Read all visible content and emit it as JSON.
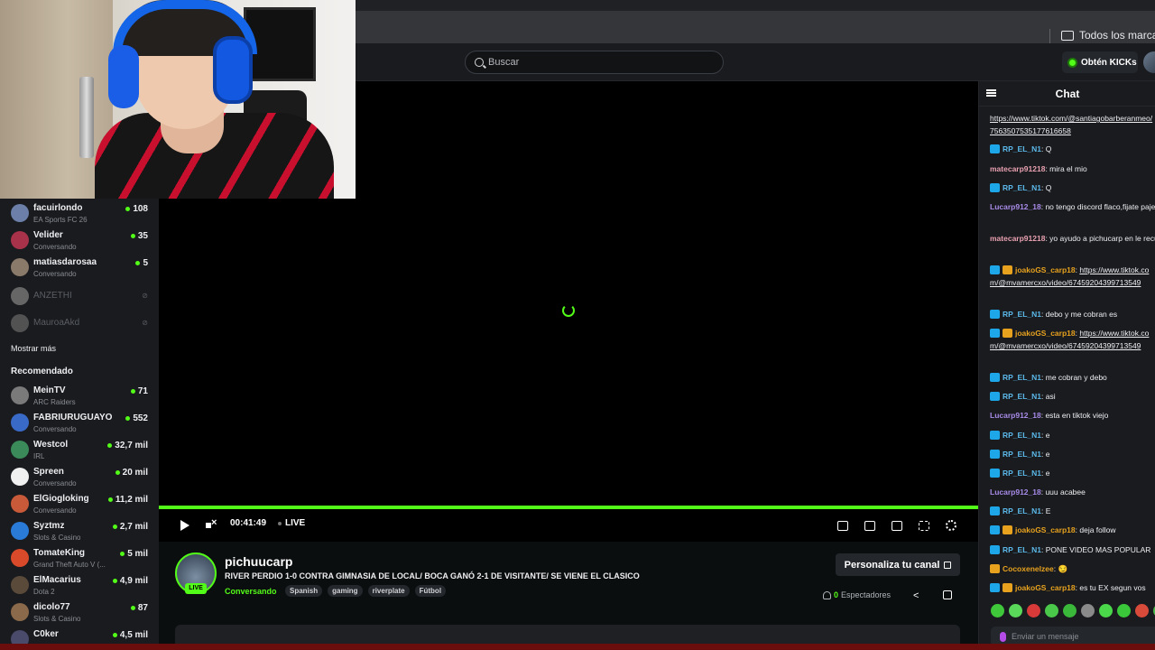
{
  "bookmarks": {
    "folder_label": "Todos los marcad"
  },
  "topnav": {
    "search_placeholder": "Buscar",
    "kicks_label": "Obtén KICKs"
  },
  "sidebar": {
    "following": [
      {
        "name": "facuirlondo",
        "sub": "EA Sports FC 26",
        "count": "108",
        "avatar": "#6b7fa8"
      },
      {
        "name": "Velider",
        "sub": "Conversando",
        "count": "35",
        "avatar": "#a8324a"
      },
      {
        "name": "matiasdarosaa",
        "sub": "Conversando",
        "count": "5",
        "avatar": "#8a7a6a"
      }
    ],
    "offline": [
      {
        "name": "ANZETHI",
        "avatar": "#aaaaaa"
      },
      {
        "name": "MauroaAkd",
        "avatar": "#888888"
      }
    ],
    "show_more": "Mostrar más",
    "recommended_heading": "Recomendado",
    "recommended": [
      {
        "name": "MeinTV",
        "sub": "ARC Raiders",
        "count": "71",
        "avatar": "#7a7a7a"
      },
      {
        "name": "FABRIURUGUAYO",
        "sub": "Conversando",
        "count": "552",
        "avatar": "#3a6ac8"
      },
      {
        "name": "Westcol",
        "sub": "IRL",
        "count": "32,7 mil",
        "avatar": "#3a8a5a"
      },
      {
        "name": "Spreen",
        "sub": "Conversando",
        "count": "20 mil",
        "avatar": "#f0f0f0"
      },
      {
        "name": "ElGiogloking",
        "sub": "Conversando",
        "count": "11,2 mil",
        "avatar": "#c85a3a"
      },
      {
        "name": "Syztmz",
        "sub": "Slots & Casino",
        "count": "2,7 mil",
        "avatar": "#2a7ad8"
      },
      {
        "name": "TomateKing",
        "sub": "Grand Theft Auto V (...",
        "count": "5 mil",
        "avatar": "#d84a2a"
      },
      {
        "name": "ElMacarius",
        "sub": "Dota 2",
        "count": "4,9 mil",
        "avatar": "#5a4a3a"
      },
      {
        "name": "dicolo77",
        "sub": "Slots & Casino",
        "count": "87",
        "avatar": "#8a6a4a"
      },
      {
        "name": "C0ker",
        "sub": "",
        "count": "4,5 mil",
        "avatar": "#4a4a6a"
      }
    ]
  },
  "player": {
    "time": "00:41:49",
    "live_label": "LIVE"
  },
  "channel": {
    "name": "pichuucarp",
    "live_badge": "LIVE",
    "title": "RIVER PERDIO 1-0 CONTRA GIMNASIA DE LOCAL/ BOCA GANÓ 2-1 DE VISITANTE/ SE VIENE EL CLASICO",
    "category": "Conversando",
    "tags": [
      "Spanish",
      "gaming",
      "riverplate",
      "Fútbol"
    ],
    "customize_label": "Personaliza tu canal",
    "viewer_count": "0",
    "viewer_label": "Espectadores"
  },
  "chat": {
    "title": "Chat",
    "input_placeholder": "Enviar un mensaje",
    "messages": [
      {
        "user": "",
        "color": "#efeff1",
        "badge": "",
        "text": "https://www.tiktok.com/@santiagobarberanmeo/7563507535177616658",
        "link": true
      },
      {
        "user": "RP_EL_N1",
        "color": "#5bb8e8",
        "badge": "blue",
        "text": "Q"
      },
      {
        "user": "matecarp91218",
        "color": "#e8a0b0",
        "badge": "",
        "text": "mira el mio"
      },
      {
        "user": "RP_EL_N1",
        "color": "#5bb8e8",
        "badge": "blue",
        "text": "Q"
      },
      {
        "user": "Lucarp912_18",
        "color": "#a88be8",
        "badge": "",
        "text": "no tengo discord flaco,fijate pajero"
      },
      {
        "user": "matecarp91218",
        "color": "#e8a0b0",
        "badge": "",
        "text": "yo ayudo a pichucarp en le recuerdo su rutina"
      },
      {
        "user": "joakoGS_carp18",
        "color": "#e8a21e",
        "badge": "both",
        "text": "https://www.tiktok.com/@mvamercxo/video/67459204399713549",
        "link": true
      },
      {
        "user": "RP_EL_N1",
        "color": "#5bb8e8",
        "badge": "blue",
        "text": "debo y me cobran es"
      },
      {
        "user": "joakoGS_carp18",
        "color": "#e8a21e",
        "badge": "both",
        "text": "https://www.tiktok.com/@mvamercxo/video/67459204399713549",
        "link": true
      },
      {
        "user": "RP_EL_N1",
        "color": "#5bb8e8",
        "badge": "blue",
        "text": "me cobran y debo"
      },
      {
        "user": "RP_EL_N1",
        "color": "#5bb8e8",
        "badge": "blue",
        "text": "asi"
      },
      {
        "user": "Lucarp912_18",
        "color": "#a88be8",
        "badge": "",
        "text": "esta en tiktok viejo"
      },
      {
        "user": "RP_EL_N1",
        "color": "#5bb8e8",
        "badge": "blue",
        "text": "e"
      },
      {
        "user": "RP_EL_N1",
        "color": "#5bb8e8",
        "badge": "blue",
        "text": "e"
      },
      {
        "user": "RP_EL_N1",
        "color": "#5bb8e8",
        "badge": "blue",
        "text": "e"
      },
      {
        "user": "Lucarp912_18",
        "color": "#a88be8",
        "badge": "",
        "text": "uuu acabee"
      },
      {
        "user": "RP_EL_N1",
        "color": "#5bb8e8",
        "badge": "blue",
        "text": "E"
      },
      {
        "user": "joakoGS_carp18",
        "color": "#e8a21e",
        "badge": "both",
        "text": "deja follow"
      },
      {
        "user": "RP_EL_N1",
        "color": "#5bb8e8",
        "badge": "blue",
        "text": "PONE VIDEO MAS POPULAR"
      },
      {
        "user": "Cocoxenelzee",
        "color": "#e8a21e",
        "badge": "gold",
        "text": "😏"
      },
      {
        "user": "joakoGS_carp18",
        "color": "#e8a21e",
        "badge": "both",
        "text": "es tu EX segun vos"
      }
    ],
    "emote_colors": [
      "#3fc83a",
      "#5ad85a",
      "#d83a3a",
      "#4ac84a",
      "#3ab83a",
      "#8a8a8a",
      "#4ad84a",
      "#3ac83a",
      "#d84a3a",
      "#4ab84a"
    ]
  },
  "theme": {
    "accent": "#53fc18",
    "background": "#191b1f",
    "player_bg": "#000000"
  }
}
